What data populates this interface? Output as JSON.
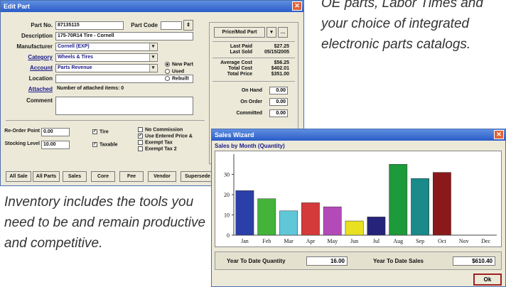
{
  "captions": {
    "right": "OE parts, Labor Times and your choice of integrated electronic parts catalogs.",
    "left": "Inventory includes the tools you need to be and remain productive and competitive."
  },
  "edit_part": {
    "title": "Edit Part",
    "part_no_label": "Part No.",
    "part_no": "87135115",
    "part_code_label": "Part Code",
    "description_label": "Description",
    "description": "175-70R14 Tire - Cornell",
    "manufacturer_label": "Manufacturer",
    "manufacturer": "Cornell (EXP)",
    "category_label": "Category",
    "category": "Wheels & Tires",
    "account_label": "Account",
    "account": "Parts Revenue",
    "location_label": "Location",
    "location": "",
    "attached_label": "Attached",
    "attached": "Number of attached items: 0",
    "comment_label": "Comment",
    "condition_options": [
      "New Part",
      "Used",
      "Rebuilt"
    ],
    "reorder_point_label": "Re-Order Point",
    "reorder_point": "0.00",
    "stocking_level_label": "Stocking Level",
    "stocking_level": "10.00",
    "tire_label": "Tire",
    "taxable_label": "Taxable",
    "checks": [
      "No Commission",
      "Use Entered Price &",
      "Exempt Tax",
      "Exempt Tax 2"
    ],
    "price_button": "Price/Mod Part",
    "panel": {
      "last_paid_label": "Last Paid",
      "last_paid": "$27.25",
      "last_sold_label": "Last Sold",
      "last_sold": "05/15/2005",
      "avg_cost_label": "Average Cost",
      "avg_cost": "$56.25",
      "total_cost_label": "Total Cost",
      "total_cost": "$402.01",
      "total_price_label": "Total Price",
      "total_price": "$351.00",
      "on_hand_label": "On Hand",
      "on_hand": "0.00",
      "on_order_label": "On Order",
      "on_order": "0.00",
      "committed_label": "Committed",
      "committed": "0.00"
    },
    "buttons": [
      "All Sale",
      "All Parts",
      "Sales",
      "Core",
      "Fee",
      "Vendor",
      "Supersede"
    ]
  },
  "sales_wizard": {
    "title": "Sales Wizard",
    "subtitle": "Sales by Month (Quantity)",
    "ytd_qty_label": "Year To Date Quantity",
    "ytd_qty": "16.00",
    "ytd_sales_label": "Year To Date Sales",
    "ytd_sales": "$610.40",
    "ok_label": "Ok"
  },
  "chart_data": {
    "type": "bar",
    "categories": [
      "Jan",
      "Feb",
      "Mar",
      "Apr",
      "May",
      "Jun",
      "Jul",
      "Aug",
      "Sep",
      "Oct",
      "Nov",
      "Dec"
    ],
    "values": [
      22,
      18,
      12,
      16,
      14,
      7,
      9,
      35,
      28,
      31,
      0,
      0
    ],
    "colors": [
      "#2b3fa8",
      "#43b33a",
      "#5fc7d8",
      "#d43a3a",
      "#b34ab8",
      "#e8e020",
      "#26237a",
      "#1d9a3a",
      "#1a8a8a",
      "#8a1a1a",
      "#999999",
      "#999999"
    ],
    "yticks": [
      0,
      10,
      20,
      30
    ],
    "ylim": [
      0,
      40
    ],
    "title": "",
    "xlabel": "",
    "ylabel": ""
  }
}
